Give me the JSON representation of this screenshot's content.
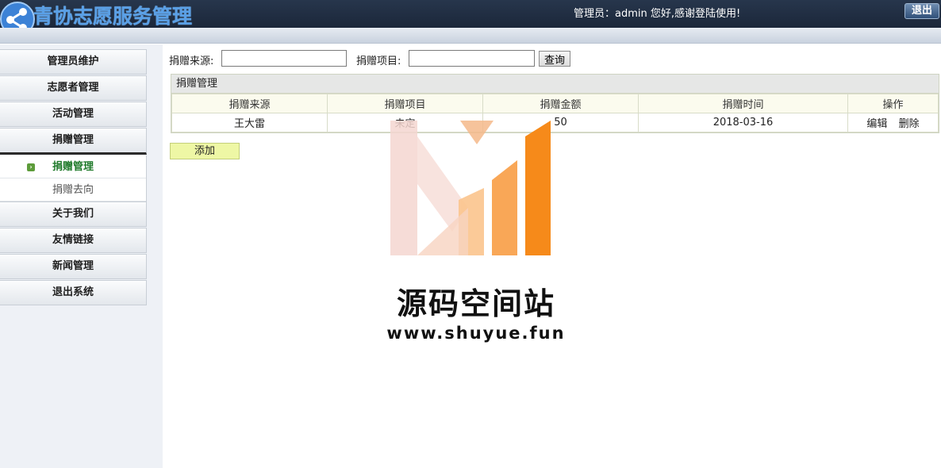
{
  "header": {
    "app_title": "青协志愿服务管理",
    "welcome_text": "管理员：admin 您好,感谢登陆使用!",
    "logout_label": "退出",
    "accent_color": "#5aa0e6"
  },
  "sidebar": {
    "items": [
      {
        "label": "管理员维护"
      },
      {
        "label": "志愿者管理"
      },
      {
        "label": "活动管理"
      },
      {
        "label": "捐赠管理"
      },
      {
        "label": "关于我们"
      },
      {
        "label": "友情链接"
      },
      {
        "label": "新闻管理"
      },
      {
        "label": "退出系统"
      }
    ],
    "submenu": [
      {
        "label": "捐赠管理",
        "active": true
      },
      {
        "label": "捐赠去向",
        "active": false
      }
    ]
  },
  "search": {
    "source_label": "捐赠来源:",
    "source_value": "",
    "project_label": "捐赠项目:",
    "project_value": "",
    "query_label": "查询"
  },
  "panel": {
    "title": "捐赠管理",
    "columns": [
      "捐赠来源",
      "捐赠项目",
      "捐赠金额",
      "捐赠时间",
      "操作"
    ],
    "rows": [
      {
        "source": "王大雷",
        "project": "未定",
        "amount": "50",
        "date": "2018-03-16",
        "edit": "编辑",
        "delete": "删除"
      }
    ]
  },
  "add_label": "添加",
  "watermark": {
    "title": "源码空间站",
    "url": "www.shuyue.fun"
  }
}
